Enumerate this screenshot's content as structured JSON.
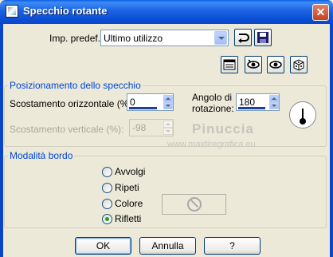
{
  "window": {
    "title": "Specchio rotante",
    "close_glyph": "✕"
  },
  "presets": {
    "label": "Imp. predef.:",
    "value": "Ultimo utilizzo"
  },
  "toolbar_icons": [
    "reset-icon",
    "save-icon",
    "edit-icon",
    "eye-toggle-icon",
    "eye-icon",
    "dice-icon"
  ],
  "mirror_group": {
    "title": "Posizionamento dello specchio",
    "horizontal_label": "Scostamento orizzontale (%):",
    "horizontal_value": "0",
    "vertical_label": "Scostamento verticale (%):",
    "vertical_value": "-98",
    "angle_label_line1": "Angolo di",
    "angle_label_line2": "rotazione:",
    "angle_value": "180"
  },
  "watermark": {
    "title": "Pinuccia",
    "subtitle": "www.maidiregrafica.eu"
  },
  "edge_group": {
    "title": "Modalità bordo",
    "options": [
      {
        "label": "Avvolgi",
        "checked": false
      },
      {
        "label": "Ripeti",
        "checked": false
      },
      {
        "label": "Colore",
        "checked": false
      },
      {
        "label": "Rifletti",
        "checked": true
      }
    ]
  },
  "buttons": {
    "ok": "OK",
    "cancel": "Annulla",
    "help": "?"
  },
  "colors": {
    "titlebar": "#0a5fe4",
    "dialog_bg": "#ece9d8",
    "group_title": "#0046d5",
    "checked_radio": "#21a121"
  }
}
